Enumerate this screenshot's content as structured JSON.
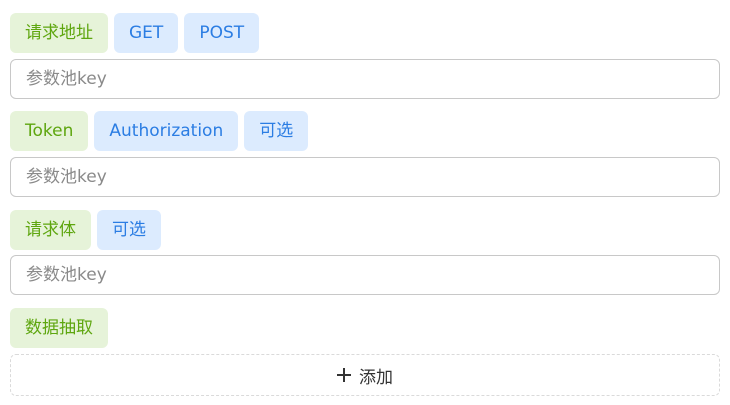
{
  "sections": {
    "request_url": {
      "label": "请求地址",
      "methods": [
        "GET",
        "POST"
      ],
      "input_placeholder": "参数池key"
    },
    "token": {
      "label": "Token",
      "options": [
        "Authorization",
        "可选"
      ],
      "input_placeholder": "参数池key"
    },
    "request_body": {
      "label": "请求体",
      "options": [
        "可选"
      ],
      "input_placeholder": "参数池key"
    },
    "data_extract": {
      "label": "数据抽取"
    }
  },
  "add_button": {
    "label": "添加",
    "icon": "plus-icon"
  },
  "colors": {
    "green_tag_bg": "#e6f3d9",
    "green_tag_text": "#5ea60f",
    "blue_tag_bg": "#dcebfe",
    "blue_tag_text": "#2b7de3"
  }
}
